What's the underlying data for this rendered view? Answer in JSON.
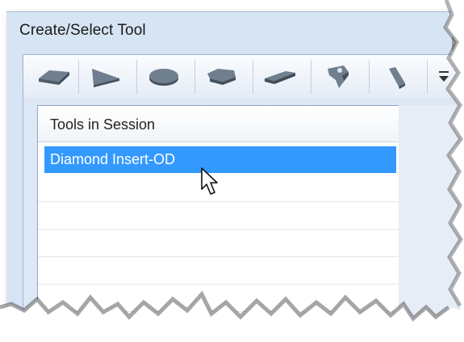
{
  "dialog": {
    "title": "Create/Select Tool"
  },
  "toolbar": {
    "buttons": [
      {
        "icon": "rhombus-insert-icon"
      },
      {
        "icon": "triangle-insert-icon"
      },
      {
        "icon": "round-insert-icon"
      },
      {
        "icon": "pentagon-insert-icon"
      },
      {
        "icon": "grooving-insert-icon"
      },
      {
        "icon": "threading-insert-icon"
      },
      {
        "icon": "parting-insert-icon"
      },
      {
        "icon": "more-dropdown-icon"
      }
    ]
  },
  "tools_list": {
    "header": "Tools in Session",
    "items": [
      {
        "label": "Diamond Insert-OD",
        "selected": true
      }
    ]
  },
  "colors": {
    "selection": "#3399ff",
    "panel": "#d6e4f3",
    "icon": "#5f6f7f"
  }
}
